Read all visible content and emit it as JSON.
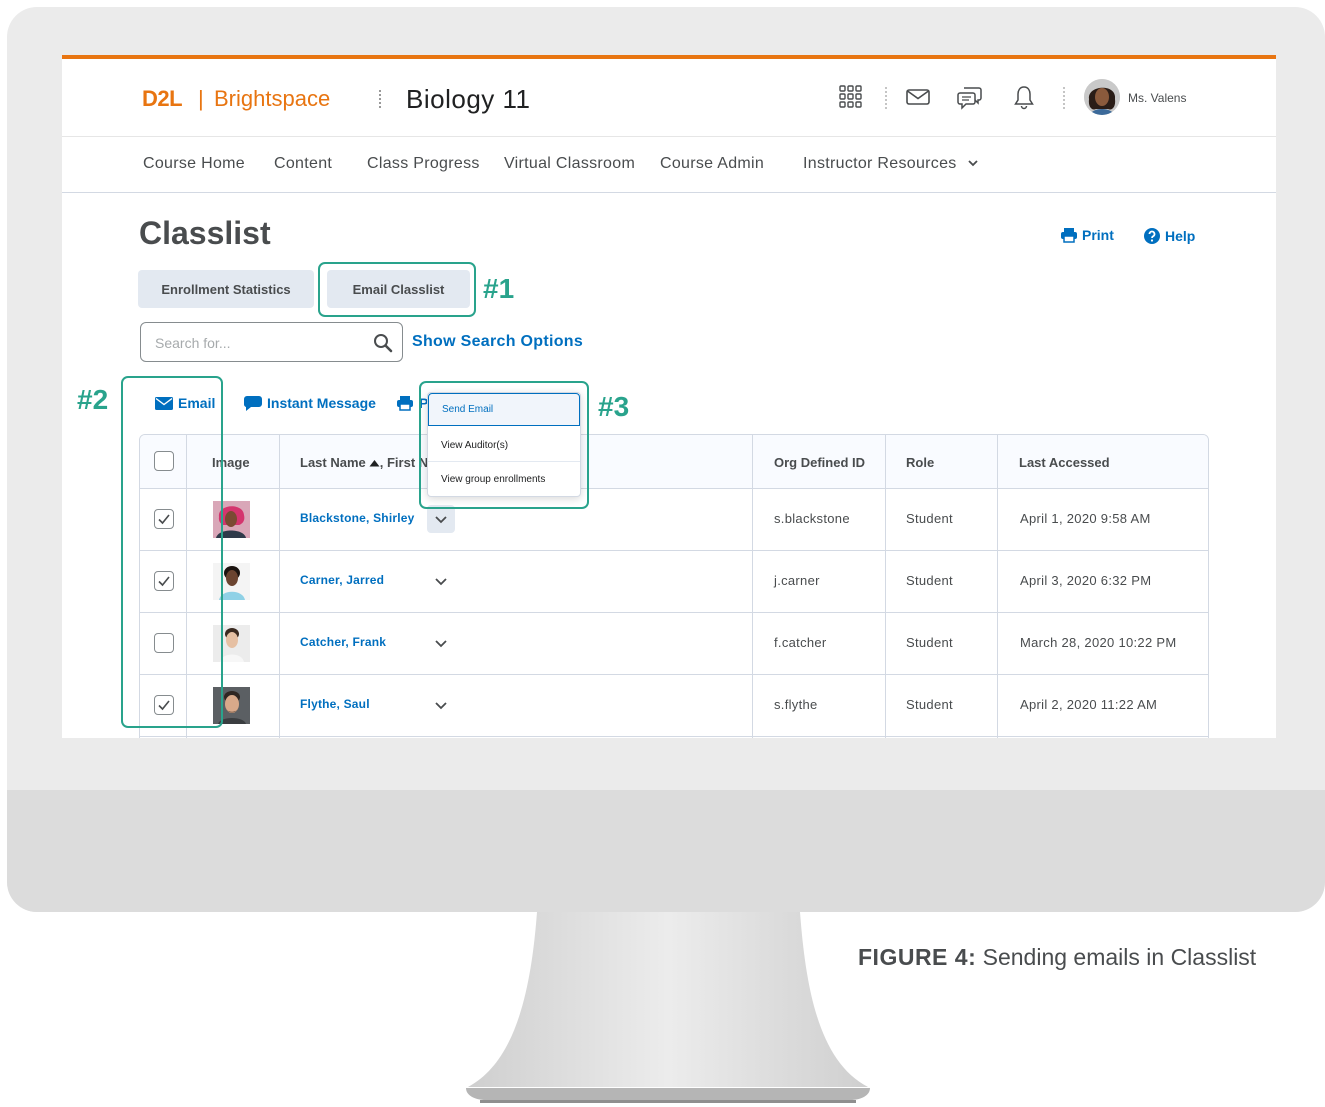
{
  "header": {
    "brand_d2l": "D2L",
    "brand_sep": "|",
    "brand_name": "Brightspace",
    "course_title": "Biology 11",
    "user_name": "Ms. Valens",
    "icons": [
      "grid-icon",
      "mail-icon",
      "chat-icon",
      "bell-icon"
    ],
    "accent_color": "#e87511"
  },
  "nav": {
    "items": [
      "Course Home",
      "Content",
      "Class Progress",
      "Virtual Classroom",
      "Course Admin",
      "Instructor Resources"
    ]
  },
  "page": {
    "title": "Classlist",
    "print_label": "Print",
    "help_label": "Help",
    "enrollment_stats_label": "Enrollment Statistics",
    "email_classlist_label": "Email Classlist",
    "search_placeholder": "Search for...",
    "search_options_label": "Show Search Options",
    "link_color": "#006fbf"
  },
  "actions": {
    "email_label": "Email",
    "im_label": "Instant Message",
    "print_partial": "P"
  },
  "table": {
    "headers": {
      "image": "Image",
      "name": "Last Name",
      "name_suffix": ", First N",
      "org_id": "Org Defined ID",
      "role": "Role",
      "last_accessed": "Last Accessed"
    },
    "rows": [
      {
        "checked": true,
        "name": "Blackstone, Shirley",
        "org_id": "s.blackstone",
        "role": "Student",
        "last_accessed": "April 1, 2020 9:58 AM"
      },
      {
        "checked": true,
        "name": "Carner, Jarred",
        "org_id": "j.carner",
        "role": "Student",
        "last_accessed": "April 3, 2020 6:32 PM"
      },
      {
        "checked": false,
        "name": "Catcher, Frank",
        "org_id": "f.catcher",
        "role": "Student",
        "last_accessed": "March 28, 2020 10:22 PM"
      },
      {
        "checked": true,
        "name": "Flythe, Saul",
        "org_id": "s.flythe",
        "role": "Student",
        "last_accessed": "April 2, 2020 11:22 AM"
      }
    ]
  },
  "menu": {
    "items": [
      "Send Email",
      "View Auditor(s)",
      "View group enrollments"
    ]
  },
  "annotations": {
    "c1": "#1",
    "c2": "#2",
    "c3": "#3",
    "color": "#29a38c"
  },
  "caption": {
    "bold": "FIGURE 4:",
    "text": " Sending emails in Classlist"
  }
}
